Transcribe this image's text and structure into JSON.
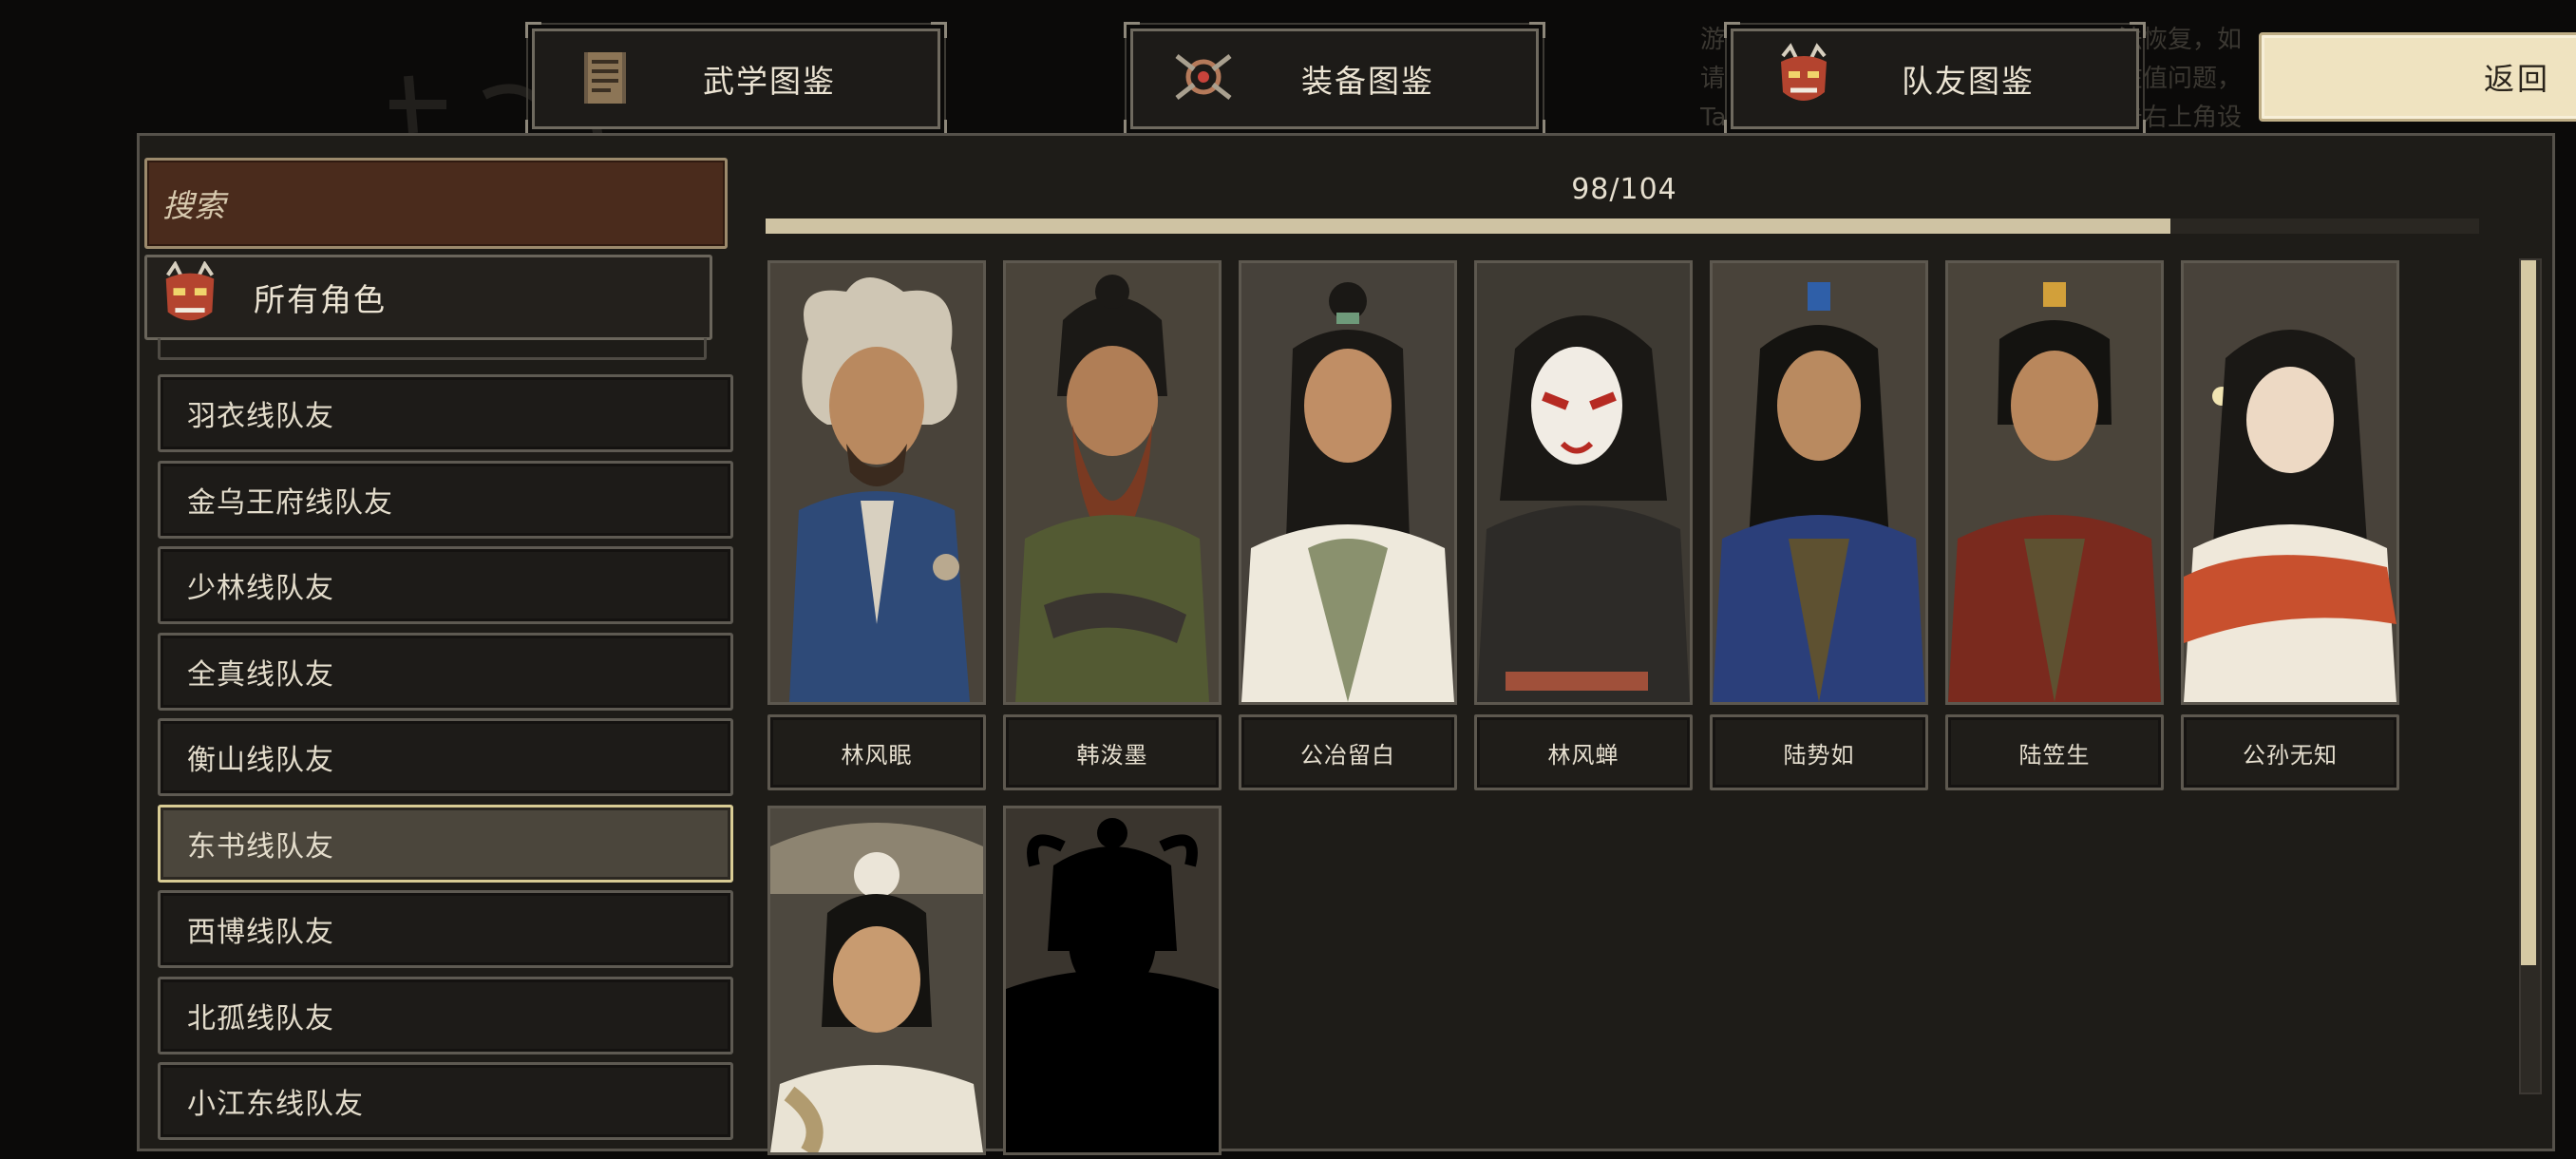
{
  "tabs": [
    {
      "label": "武学图鉴",
      "icon": "manual-book-icon"
    },
    {
      "label": "装备图鉴",
      "icon": "equipment-icon"
    },
    {
      "label": "队友图鉴",
      "icon": "teammate-demon-mask-icon"
    }
  ],
  "back_label": "返回",
  "background_text": [
    "游",
    "请",
    "Ta"
  ],
  "background_text_right": [
    "法恢复，如",
    "在值问题，",
    "击右上角设"
  ],
  "search": {
    "placeholder": "搜索"
  },
  "all_roles_label": "所有角色",
  "categories": [
    {
      "label": "羽衣线队友",
      "active": false
    },
    {
      "label": "金乌王府线队友",
      "active": false
    },
    {
      "label": "少林线队友",
      "active": false
    },
    {
      "label": "全真线队友",
      "active": false
    },
    {
      "label": "衡山线队友",
      "active": false
    },
    {
      "label": "东书线队友",
      "active": true
    },
    {
      "label": "西博线队友",
      "active": false
    },
    {
      "label": "北孤线队友",
      "active": false
    },
    {
      "label": "小江东线队友",
      "active": false
    }
  ],
  "progress": {
    "text": "98/104",
    "collected": 98,
    "total": 104
  },
  "companions": [
    {
      "name": "林风眠",
      "unlocked": true
    },
    {
      "name": "韩泼墨",
      "unlocked": true
    },
    {
      "name": "公冶留白",
      "unlocked": true
    },
    {
      "name": "林风蝉",
      "unlocked": true
    },
    {
      "name": "陆势如",
      "unlocked": true
    },
    {
      "name": "陆笠生",
      "unlocked": true
    },
    {
      "name": "公孙无知",
      "unlocked": true
    }
  ],
  "companions_row2": [
    {
      "unlocked": true
    },
    {
      "unlocked": false
    }
  ],
  "colors": {
    "accent": "#efe3c0",
    "panel": "#1e1c18",
    "search_bg": "#4a2b1c",
    "active_border": "#d9cc94",
    "progress": "#cfc3a3"
  }
}
